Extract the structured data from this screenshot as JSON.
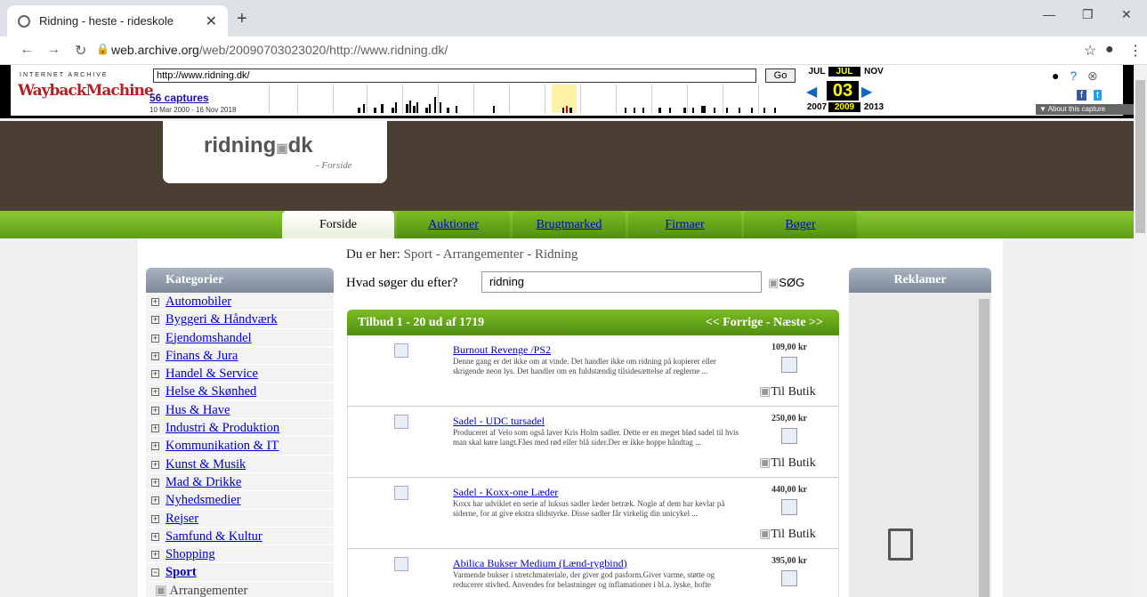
{
  "browser": {
    "tab_title": "Ridning - heste - rideskole",
    "url_host": "web.archive.org",
    "url_path": "/web/20090703023020/http://www.ridning.dk/"
  },
  "wayback": {
    "logo_top": "INTERNET ARCHIVE",
    "logo_main": "WaybackMachine",
    "url_value": "http://www.ridning.dk/",
    "go": "Go",
    "captures": "56 captures",
    "range": "10 Mar 2000 - 16 Nov 2018",
    "months": [
      "JUL",
      "JUL",
      "NOV"
    ],
    "day": "03",
    "years": [
      "2007",
      "2009",
      "2013"
    ],
    "about": "▼ About this capture"
  },
  "site": {
    "logo": "ridning",
    "logo_tld": "dk",
    "logo_sub": "- Forside",
    "tabs": [
      "Forside",
      "Auktioner",
      "Brugtmarked",
      "Firmaer",
      "Bøger"
    ]
  },
  "breadcrumb": {
    "prefix": "Du er her:",
    "path": "Sport - Arrangementer - Ridning"
  },
  "search": {
    "label": "Hvad søger du efter?",
    "value": "ridning",
    "button": "SØG"
  },
  "categories": {
    "title": "Kategorier",
    "items": [
      "Automobiler",
      "Byggeri & Håndværk",
      "Ejendomshandel",
      "Finans & Jura",
      "Handel & Service",
      "Helse & Skønhed",
      "Hus & Have",
      "Industri & Produktion",
      "Kommunikation & IT",
      "Kunst & Musik",
      "Mad & Drikke",
      "Nyhedsmedier",
      "Rejser",
      "Samfund & Kultur",
      "Shopping"
    ],
    "open": "Sport",
    "sub": "Arrangementer"
  },
  "results": {
    "header": "Tilbud 1 - 20 ud af 1719",
    "nav": "<< Forrige - Næste >>",
    "shop_label": "Til Butik",
    "items": [
      {
        "title": "Burnout Revenge  /PS2",
        "desc": "Denne gang er det ikke om at vinde. Det handler ikke om ridning på kopierer eller skrigende neon lys. Det handler om en fuldstændig tilsidesættelse af reglerne ...",
        "price": "109,00 kr"
      },
      {
        "title": "Sadel - UDC tursadel",
        "desc": "Produceret af Velo som også laver Kris Holm sadler. Dette er en meget blød sadel til hvis man skal køre langt.Fåes med rød eller blå sider.Der er ikke hoppe håndtag ...",
        "price": "250,00 kr"
      },
      {
        "title": "Sadel - Koxx-one Læder",
        "desc": "Koxx har udviklet en serie af luksus sadler læder betræk. Nogle af dem har kevlar på siderne, for at give ekstra slidstyrke. Disse sadler får virkelig din unicykel ...",
        "price": "440,00 kr"
      },
      {
        "title": "Abilica Bukser Medium (Lænd-rygbind)",
        "desc": "Varmende bukser i stretchmateriale, der giver god pasform.Giver varme, støtte og reducerer stivhed. Anvendes for belastninger og inflamationer i bl.a. lyske, hofte",
        "price": "395,00 kr"
      }
    ]
  },
  "ads": {
    "title": "Reklamer"
  }
}
